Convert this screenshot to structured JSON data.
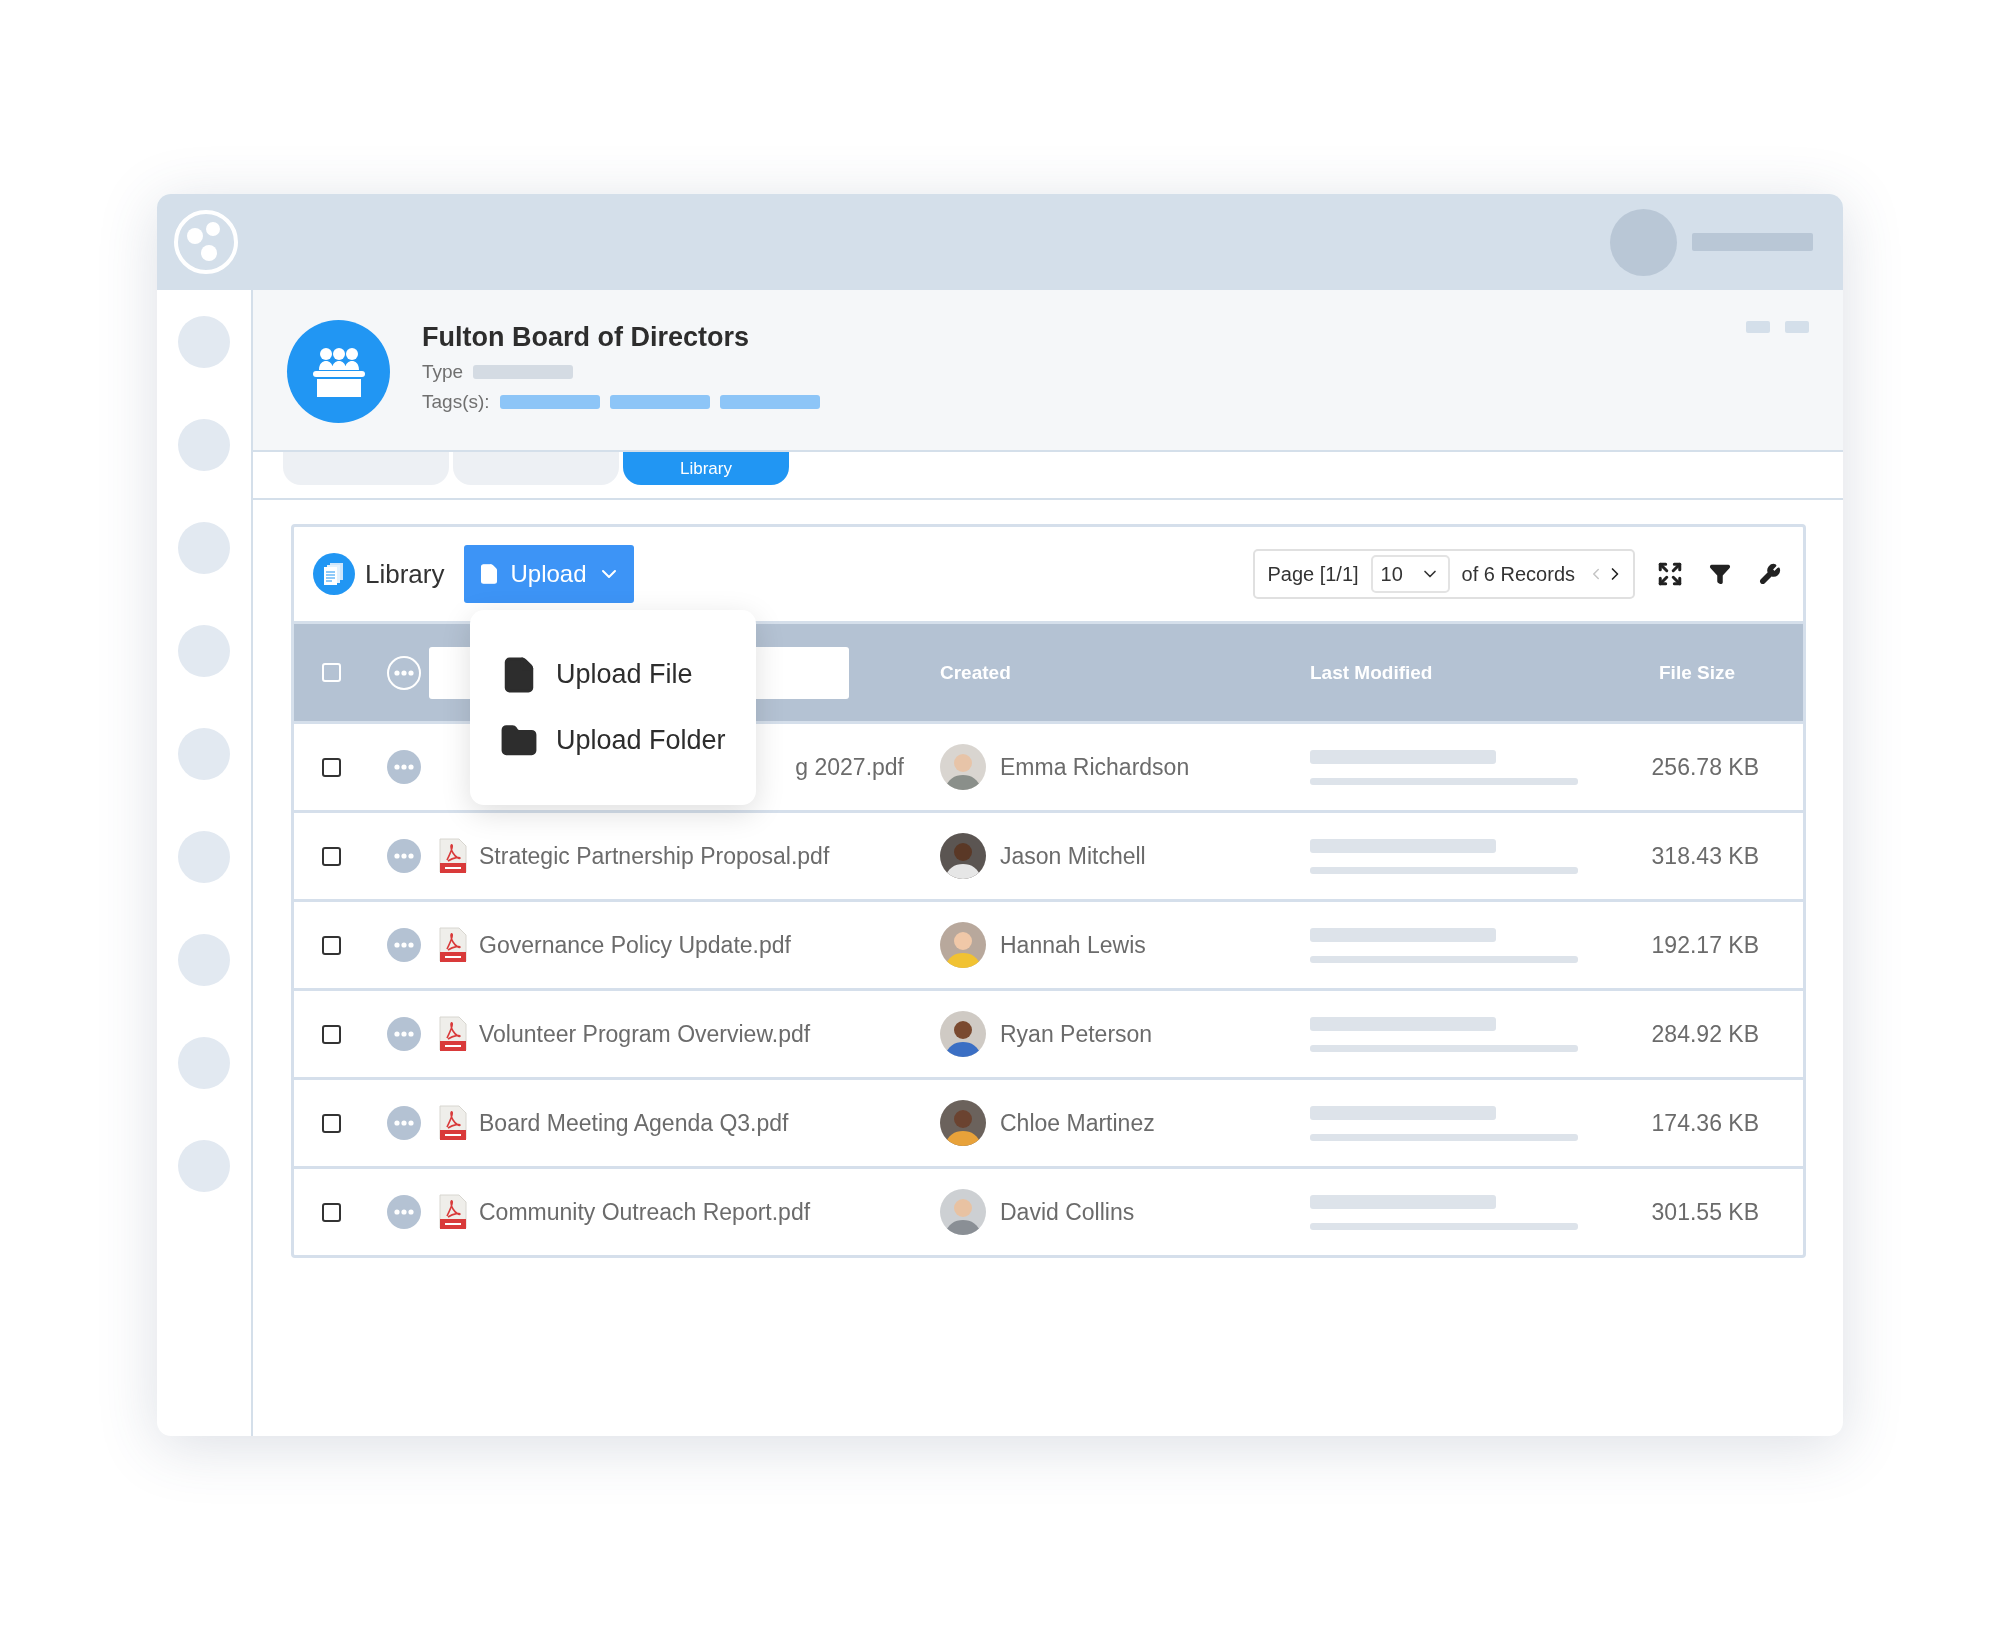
{
  "header": {
    "title": "Fulton Board of Directors",
    "type_label": "Type",
    "tags_label": "Tags(s):"
  },
  "tabs": [
    {
      "selected": false
    },
    {
      "selected": false
    },
    {
      "label": "Library",
      "selected": true
    }
  ],
  "library": {
    "title": "Library",
    "upload_button": "Upload",
    "menu_open": true,
    "upload_menu": [
      {
        "kind": "file",
        "label": "Upload File"
      },
      {
        "kind": "folder",
        "label": "Upload Folder"
      }
    ],
    "pagination": {
      "page": "Page [1/1]",
      "page_size": "10",
      "records": "of 6 Records",
      "prev_disabled": true,
      "next_disabled": false
    }
  },
  "table": {
    "select_all_checked": false,
    "columns": [
      "Created",
      "Last Modified",
      "File Size"
    ],
    "rows": [
      {
        "checked": false,
        "covered": true,
        "name": "g 2027.pdf",
        "created_by": "Emma Richardson",
        "file_size": "256.78 KB"
      },
      {
        "checked": false,
        "covered": false,
        "name": "Strategic Partnership Proposal.pdf",
        "created_by": "Jason Mitchell",
        "file_size": "318.43 KB"
      },
      {
        "checked": false,
        "covered": false,
        "name": "Governance Policy Update.pdf",
        "created_by": "Hannah Lewis",
        "file_size": "192.17 KB"
      },
      {
        "checked": false,
        "covered": false,
        "name": "Volunteer Program Overview.pdf",
        "created_by": "Ryan Peterson",
        "file_size": "284.92 KB"
      },
      {
        "checked": false,
        "covered": false,
        "name": "Board Meeting Agenda Q3.pdf",
        "created_by": "Chloe Martinez",
        "file_size": "174.36 KB"
      },
      {
        "checked": false,
        "covered": false,
        "name": "Community Outreach Report.pdf",
        "created_by": "David Collins",
        "file_size": "301.55 KB"
      }
    ]
  }
}
